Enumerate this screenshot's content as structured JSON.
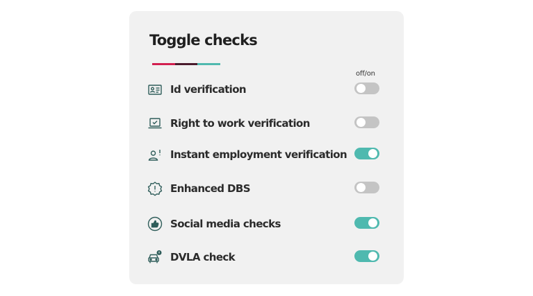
{
  "panel": {
    "title": "Toggle checks",
    "column_header": "off/on",
    "accent_colors": [
      "#d21f4f",
      "#4a1a2c",
      "#4fb9af"
    ]
  },
  "colors": {
    "toggle_on": "#4fb9af",
    "toggle_off": "#c4c4c4",
    "icon": "#2f5d5a"
  },
  "checks": [
    {
      "label": "Id verification",
      "icon": "id-card-icon",
      "on": false
    },
    {
      "label": "Right to work verification",
      "icon": "laptop-check-icon",
      "on": false
    },
    {
      "label": "Instant employment verification",
      "icon": "person-alert-icon",
      "on": true
    },
    {
      "label": "Enhanced DBS",
      "icon": "badge-alert-icon",
      "on": false
    },
    {
      "label": "Social media checks",
      "icon": "thumbs-up-icon",
      "on": true
    },
    {
      "label": "DVLA check",
      "icon": "car-alert-icon",
      "on": true
    }
  ]
}
